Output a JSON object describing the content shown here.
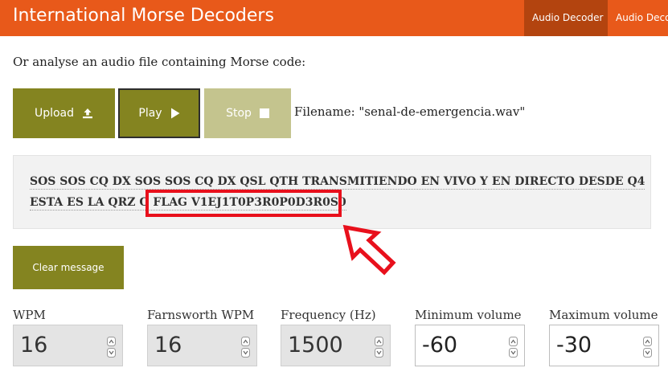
{
  "header": {
    "title": "International Morse Decoders",
    "nav": [
      {
        "label": "Audio Decoder",
        "active": true
      },
      {
        "label": "Audio Decoder"
      }
    ]
  },
  "intro_text": "Or analyse an audio file containing Morse code:",
  "buttons": {
    "upload": {
      "label": "Upload",
      "icon": "upload-icon"
    },
    "play": {
      "label": "Play",
      "icon": "play-icon"
    },
    "stop": {
      "label": "Stop",
      "icon": "stop-icon"
    }
  },
  "filename_text": "Filename: \"senal-de-emergencia.wav\"",
  "message": {
    "line1": "SOS SOS CQ DX SOS SOS CQ DX QSL QTH TRANSMITIENDO EN VIVO Y EN DIRECTO DESDE Q4",
    "line2_prefix": "ESTA ES LA QRZ O",
    "line2_flag": "FLAG V1EJ1T0P3R0P0D3R0S0"
  },
  "clear_button": "Clear message",
  "fields": [
    {
      "label": "WPM",
      "value": "16",
      "disabled": true
    },
    {
      "label": "Farnsworth WPM",
      "value": "16",
      "disabled": true
    },
    {
      "label": "Frequency (Hz)",
      "value": "1500",
      "disabled": true
    },
    {
      "label": "Minimum volume",
      "value": "-60",
      "disabled": false
    },
    {
      "label": "Maximum volume",
      "value": "-30",
      "disabled": false
    }
  ],
  "colors": {
    "header_bg": "#e8591a",
    "active_tab_bg": "#b3440f",
    "olive_button": "#848420",
    "disabled_button": "#c4c48e",
    "highlight_red": "#e8101c"
  }
}
